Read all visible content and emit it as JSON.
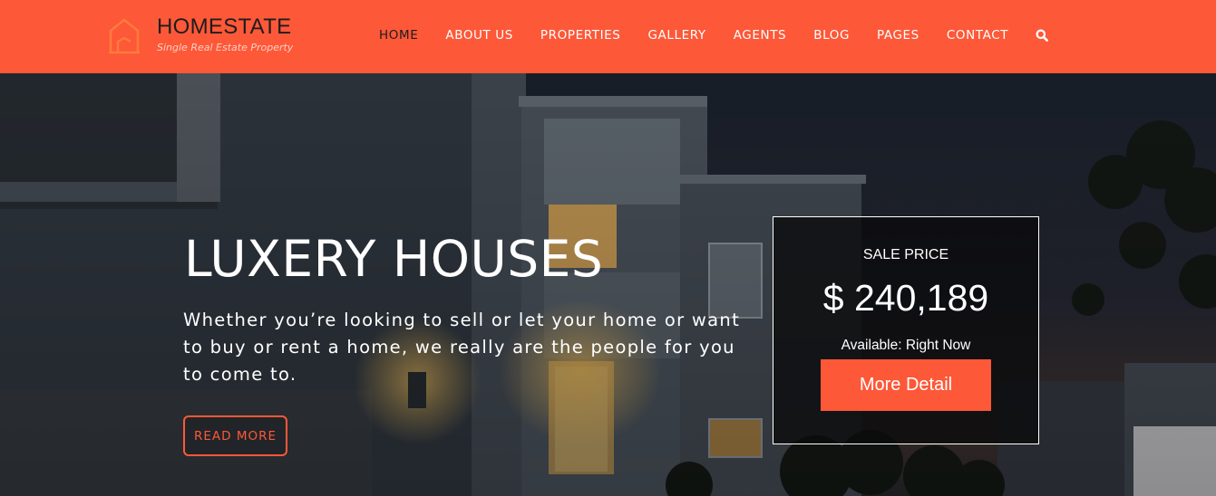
{
  "colors": {
    "accent": "#fd5838",
    "header_text_active": "#1d1d1d",
    "header_text": "#ffffff",
    "price_box_bg": "#0a0a0c",
    "hero_overlay": "#1e2530"
  },
  "header": {
    "brand": "HOMESTATE",
    "tagline": "Single Real Estate Property",
    "logo_icon": "house-outline-icon",
    "nav": [
      {
        "label": "HOME",
        "active": true
      },
      {
        "label": "ABOUT US",
        "active": false
      },
      {
        "label": "PROPERTIES",
        "active": false
      },
      {
        "label": "GALLERY",
        "active": false
      },
      {
        "label": "AGENTS",
        "active": false
      },
      {
        "label": "BLOG",
        "active": false
      },
      {
        "label": "PAGES",
        "active": false
      },
      {
        "label": "CONTACT",
        "active": false
      }
    ],
    "search_icon": "search-icon"
  },
  "hero": {
    "title": "LUXERY HOUSES",
    "text": "Whether you’re looking to sell or let your home or want to buy or rent a home, we really are the people for you to come to.",
    "read_more_label": "READ MORE",
    "background": "modern-house-at-dusk-photo"
  },
  "price_box": {
    "sale_label": "SALE PRICE",
    "price": "$ 240,189",
    "availability": "Available: Right Now",
    "button_label": "More Detail"
  }
}
